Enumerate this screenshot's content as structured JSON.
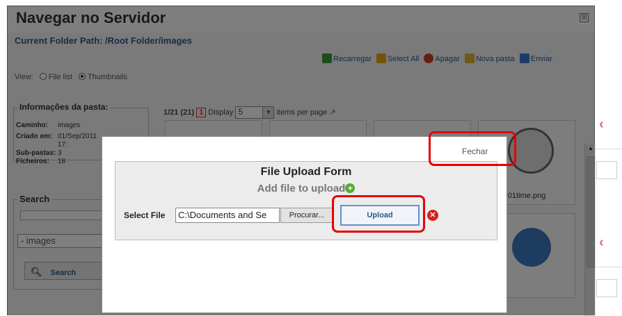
{
  "window": {
    "title": "Navegar no Servidor",
    "close_glyph": "☒"
  },
  "path": {
    "label": "Current Folder Path:",
    "value": "/Root Folder/images"
  },
  "toolbar": {
    "items": [
      {
        "label": "Recarregar",
        "icon": "refresh-icon",
        "color": "#3a9a3a"
      },
      {
        "label": "Select All",
        "icon": "select-all-icon",
        "color": "#e8a21a"
      },
      {
        "label": "Apagar",
        "icon": "delete-icon",
        "color": "#d23a2a"
      },
      {
        "label": "Nova pasta",
        "icon": "new-folder-icon",
        "color": "#e0b030"
      },
      {
        "label": "Enviar",
        "icon": "upload-arrow-icon",
        "color": "#3a7ad0"
      }
    ]
  },
  "view": {
    "label": "View:",
    "options": [
      "File list",
      "Thumbnails"
    ],
    "selected": "Thumbnails"
  },
  "folder_info": {
    "legend": "Informações da pasta:",
    "rows": [
      {
        "key": "Caminho:",
        "value": "images"
      },
      {
        "key": "Criado em:",
        "value": "01/Sep/2011"
      },
      {
        "key": "",
        "value": "17:"
      },
      {
        "key": "Sub-pastas:",
        "value": "3"
      },
      {
        "key": "Ficheiros:",
        "value": "18"
      }
    ]
  },
  "search": {
    "legend": "Search",
    "folder_selected": "- images",
    "button_label": "Search"
  },
  "pager": {
    "count": "1/21 (21)",
    "page": "1",
    "display_label": "Display",
    "per_page": "5",
    "suffix": "items per page"
  },
  "thumbnails": [
    {
      "label": ""
    },
    {
      "label": ""
    },
    {
      "label": ""
    },
    {
      "label": "01time.png"
    },
    {
      "label": ""
    }
  ],
  "upload_modal": {
    "close_label": "Fechar",
    "form_title": "File Upload Form",
    "add_file_label": "Add file to upload",
    "select_file_label": "Select File",
    "file_value": "C:\\Documents and Se",
    "browse_label": "Procurar...",
    "upload_label": "Upload"
  },
  "colors": {
    "highlight": "#e60000",
    "link": "#2d5a8a"
  }
}
